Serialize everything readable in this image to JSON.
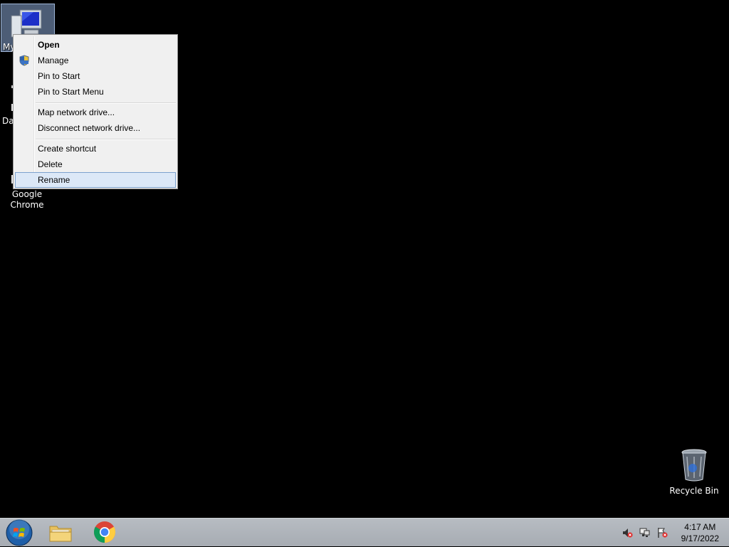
{
  "desktop": {
    "icons": [
      {
        "label": "My"
      },
      {
        "label": "Da"
      },
      {
        "label": "Google Chrome"
      },
      {
        "label": "Recycle Bin"
      }
    ]
  },
  "context_menu": {
    "items": [
      {
        "label": "Open",
        "icon": "uac-shield-icon-none"
      },
      {
        "label": "Manage",
        "icon": "uac-shield-icon"
      },
      {
        "label": "Pin to Start"
      },
      {
        "label": "Pin to Start Menu"
      },
      {
        "label": "Map network drive..."
      },
      {
        "label": "Disconnect network drive..."
      },
      {
        "label": "Create shortcut"
      },
      {
        "label": "Delete"
      },
      {
        "label": "Rename"
      }
    ],
    "highlighted": "Rename"
  },
  "taskbar": {
    "buttons": [
      "start-button",
      "file-explorer",
      "google-chrome"
    ],
    "tray_icons": [
      "speaker-muted-icon",
      "network-disconnected-icon",
      "action-center-flag-icon"
    ],
    "clock": {
      "time": "4:17 AM",
      "date": "9/17/2022"
    }
  }
}
